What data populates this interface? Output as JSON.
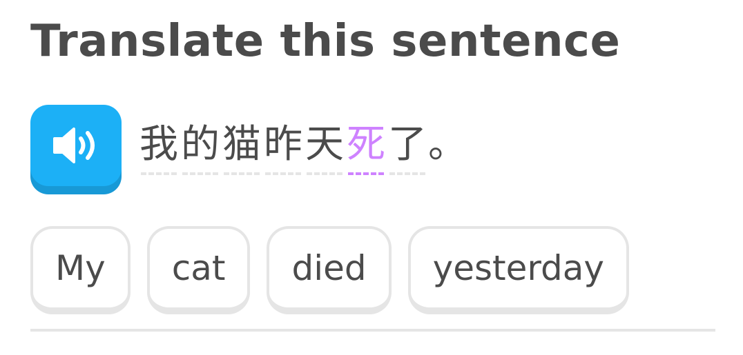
{
  "header": {
    "title": "Translate this sentence"
  },
  "prompt": {
    "audio_icon": "speaker-icon",
    "characters": [
      {
        "text": "我",
        "highlight": false
      },
      {
        "text": "的",
        "highlight": false
      },
      {
        "text": "猫",
        "highlight": false
      },
      {
        "text": "昨",
        "highlight": false
      },
      {
        "text": "天",
        "highlight": false
      },
      {
        "text": "死",
        "highlight": true
      },
      {
        "text": "了",
        "highlight": false
      }
    ],
    "punctuation": "。"
  },
  "word_bank": {
    "tiles": [
      "My",
      "cat",
      "died",
      "yesterday"
    ]
  },
  "colors": {
    "title_text": "#4b4b4b",
    "audio_button": "#1cb0f6",
    "audio_button_shadow": "#1899d6",
    "highlight": "#ce82ff",
    "tile_border": "#e5e5e5"
  }
}
